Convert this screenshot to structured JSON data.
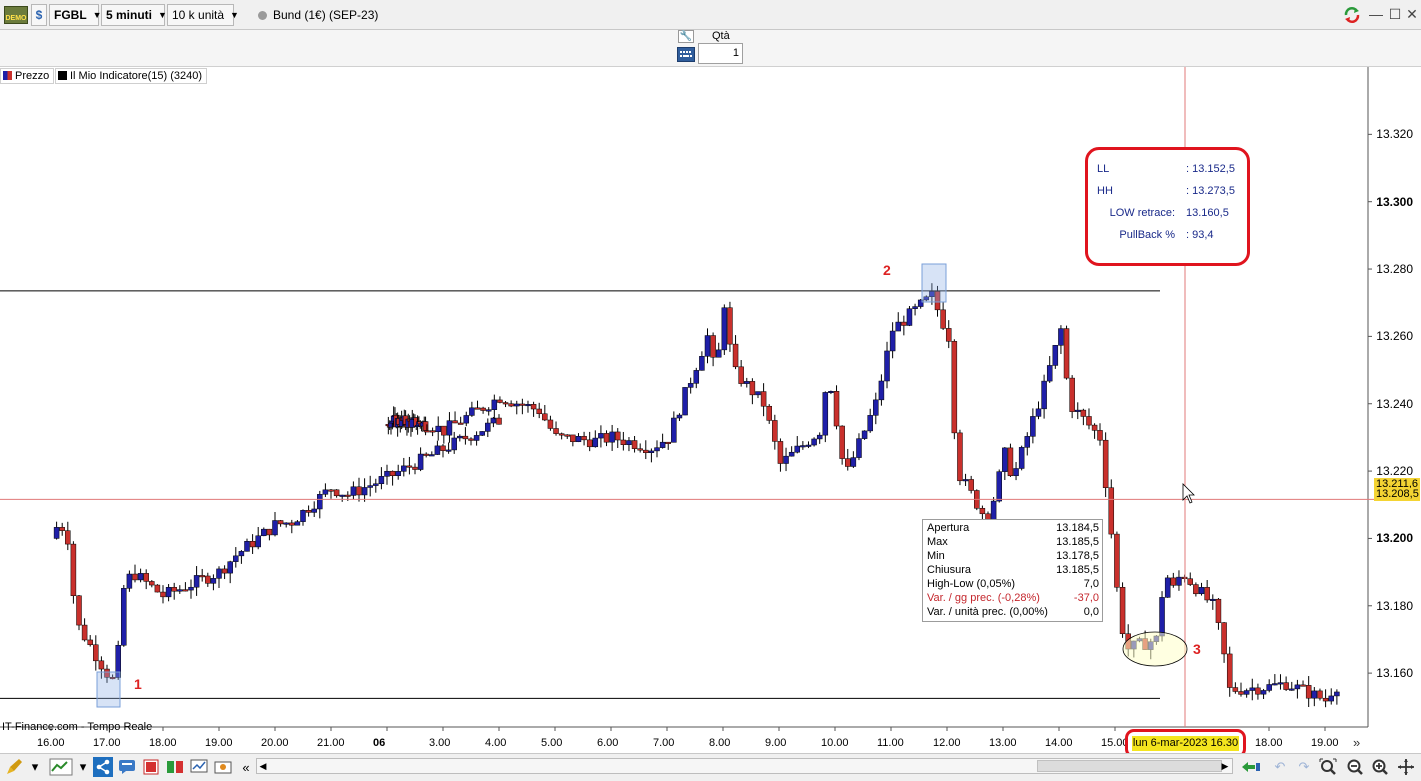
{
  "titlebar": {
    "demo_badge": "DEMO",
    "symbol": "FGBL",
    "timeframe": "5 minuti",
    "units": "10 k unità",
    "instrument": "Bund (1€) (SEP-23)"
  },
  "orderbar": {
    "qty_label": "Qtà",
    "qty_value": "1"
  },
  "legend": {
    "price": "Prezzo",
    "indicator": "Il Mio Indicatore(15) (3240)"
  },
  "markers": {
    "one": "1",
    "two": "2",
    "three": "3"
  },
  "info_panel": {
    "ll_label": "LL",
    "ll_value": ": 13.152,5",
    "hh_label": "HH",
    "hh_value": ": 13.273,5",
    "low_retrace_label": "LOW retrace:",
    "low_retrace_value": "13.160,5",
    "pullback_label": "PullBack %",
    "pullback_value": ": 93,4"
  },
  "ohlc_tooltip": {
    "rows": [
      {
        "k": "Apertura",
        "v": "13.184,5"
      },
      {
        "k": "Max",
        "v": "13.185,5"
      },
      {
        "k": "Min",
        "v": "13.178,5"
      },
      {
        "k": "Chiusura",
        "v": "13.185,5"
      },
      {
        "k": "High-Low (0,05%)",
        "v": "7,0"
      },
      {
        "k": "Var. / gg prec. (-0,28%)",
        "v": "-37,0"
      },
      {
        "k": "Var. / unità prec. (0,00%)",
        "v": "0,0"
      }
    ]
  },
  "price_tags": {
    "cursor": "13.211,6",
    "last": "13.208,5"
  },
  "source_label": "IT-Finance.com - Tempo Reale",
  "cursor_date": "lun 6-mar-2023 16.30",
  "colors": {
    "up": "#1f1fa8",
    "down": "#c9302c",
    "highlight": "#e0141e",
    "cursor": "#e07878"
  },
  "chart_data": {
    "type": "candlestick",
    "y_ticks": [
      "13.320",
      "13.300",
      "13.280",
      "13.260",
      "13.240",
      "13.220",
      "13.200",
      "13.180",
      "13.160"
    ],
    "y_bold_ticks": [
      "13.300",
      "13.200"
    ],
    "x_ticks": [
      "16.00",
      "17.00",
      "18.00",
      "19.00",
      "20.00",
      "21.00",
      "06",
      "3.00",
      "4.00",
      "5.00",
      "6.00",
      "7.00",
      "8.00",
      "9.00",
      "10.00",
      "11.00",
      "12.00",
      "13.00",
      "14.00",
      "15.00",
      "18.00",
      "19.00"
    ],
    "ylim": [
      13.144,
      13.34
    ],
    "levels": {
      "ll": 13.1525,
      "hh": 13.2735,
      "cursor_price": 13.2116
    },
    "close_path": [
      [
        "16.00",
        13.2
      ],
      [
        "16.15",
        13.205
      ],
      [
        "16.30",
        13.2
      ],
      [
        "16.45",
        13.175
      ],
      [
        "17.00",
        13.16
      ],
      [
        "17.15",
        13.157
      ],
      [
        "17.30",
        13.185
      ],
      [
        "17.45",
        13.19
      ],
      [
        "18.00",
        13.183
      ],
      [
        "18.30",
        13.185
      ],
      [
        "19.00",
        13.19
      ],
      [
        "19.30",
        13.195
      ],
      [
        "20.00",
        13.204
      ],
      [
        "20.30",
        13.205
      ],
      [
        "21.00",
        13.215
      ],
      [
        "21.30",
        13.213
      ],
      [
        "22.00",
        13.218
      ],
      [
        "06",
        13.235
      ],
      [
        "3.00",
        13.234
      ],
      [
        "3.30",
        13.232
      ],
      [
        "4.00",
        13.239
      ],
      [
        "4.30",
        13.242
      ],
      [
        "5.00",
        13.238
      ],
      [
        "5.30",
        13.23
      ],
      [
        "6.00",
        13.229
      ],
      [
        "6.30",
        13.23
      ],
      [
        "7.00",
        13.227
      ],
      [
        "7.30",
        13.23
      ],
      [
        "8.00",
        13.26
      ],
      [
        "8.15",
        13.248
      ],
      [
        "8.30",
        13.27
      ],
      [
        "8.45",
        13.25
      ],
      [
        "9.00",
        13.24
      ],
      [
        "9.30",
        13.222
      ],
      [
        "10.00",
        13.232
      ],
      [
        "10.15",
        13.25
      ],
      [
        "10.30",
        13.235
      ],
      [
        "10.45",
        13.218
      ],
      [
        "11.00",
        13.24
      ],
      [
        "11.30",
        13.262
      ],
      [
        "12.00",
        13.272
      ],
      [
        "12.30",
        13.26
      ],
      [
        "12.45",
        13.22
      ],
      [
        "13.00",
        13.205
      ],
      [
        "13.30",
        13.225
      ],
      [
        "13.45",
        13.218
      ],
      [
        "14.00",
        13.245
      ],
      [
        "14.30",
        13.262
      ],
      [
        "14.45",
        13.24
      ],
      [
        "15.00",
        13.23
      ],
      [
        "15.15",
        13.21
      ],
      [
        "15.30",
        13.185
      ],
      [
        "15.45",
        13.167
      ],
      [
        "16.00",
        13.17
      ],
      [
        "16.15",
        13.19
      ],
      [
        "16.30",
        13.185
      ],
      [
        "16.45",
        13.19
      ],
      [
        "17.00",
        13.18
      ],
      [
        "17.15",
        13.17
      ],
      [
        "17.30",
        13.155
      ],
      [
        "18.00",
        13.156
      ],
      [
        "18.30",
        13.157
      ],
      [
        "19.00",
        13.152
      ],
      [
        "19.15",
        13.156
      ],
      [
        "19.30",
        13.157
      ]
    ]
  }
}
